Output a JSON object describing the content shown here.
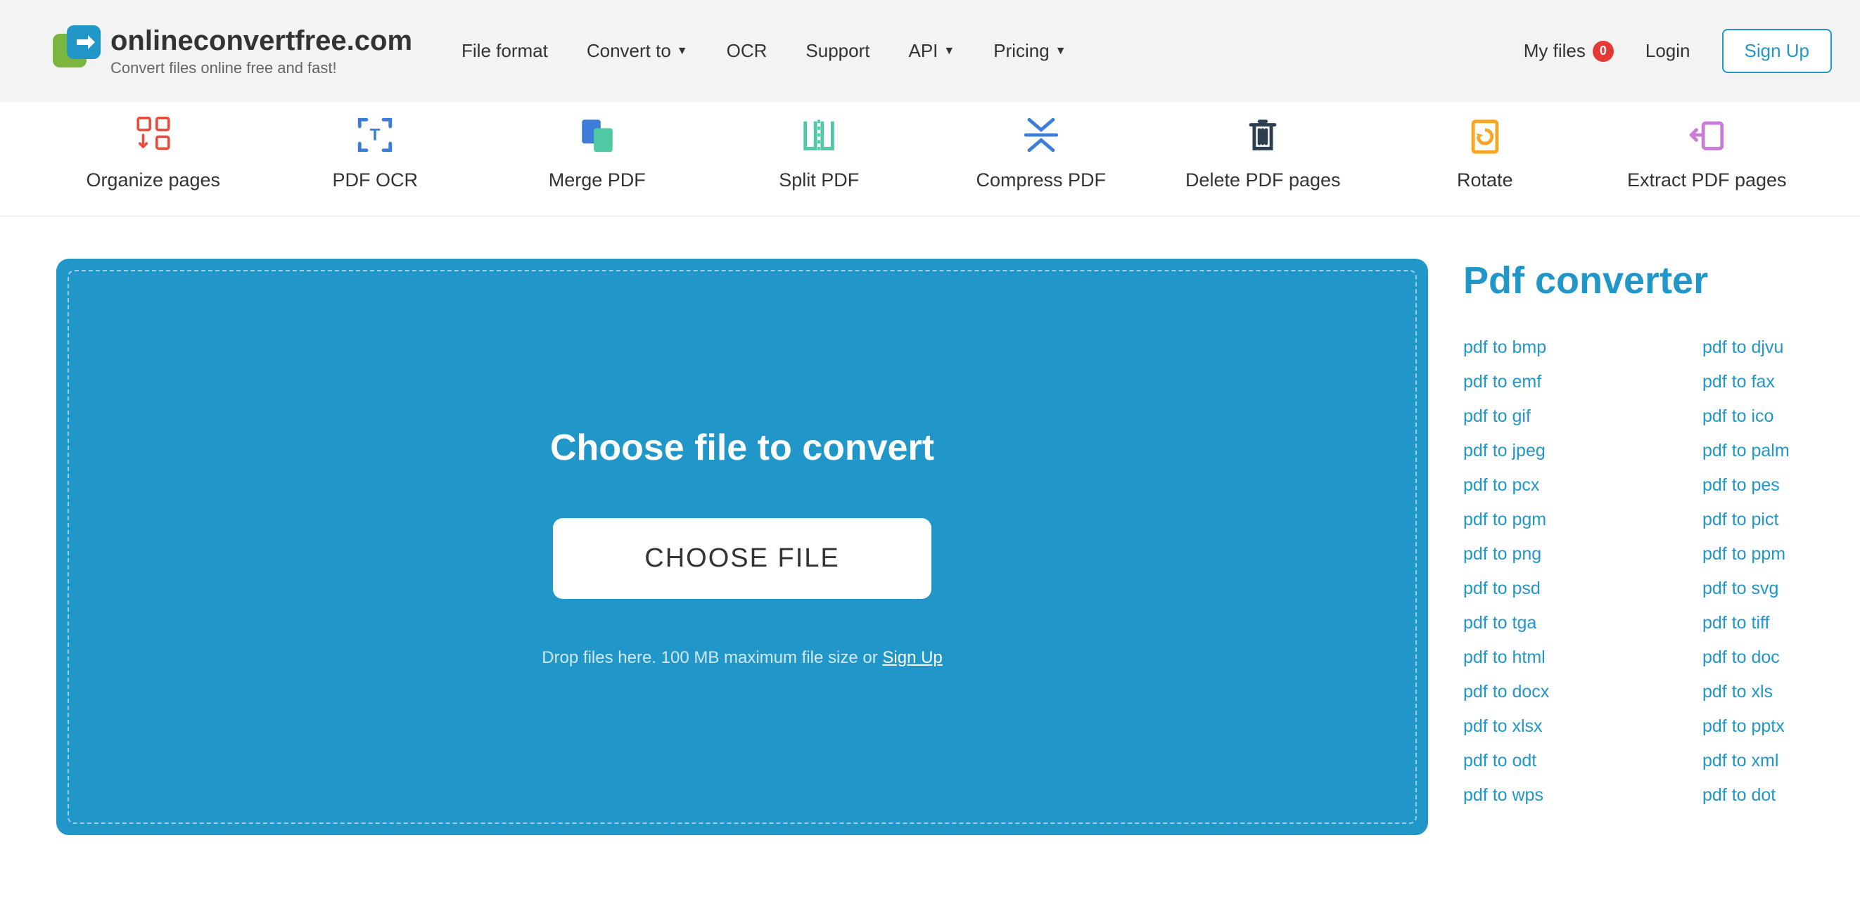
{
  "header": {
    "logo_title": "onlineconvertfree.com",
    "logo_sub": "Convert files online free and fast!",
    "nav": {
      "file_format": "File format",
      "convert_to": "Convert to",
      "ocr": "OCR",
      "support": "Support",
      "api": "API",
      "pricing": "Pricing"
    },
    "my_files": "My files",
    "my_files_count": "0",
    "login": "Login",
    "signup": "Sign Up"
  },
  "tools": {
    "organize": "Organize pages",
    "ocr": "PDF OCR",
    "merge": "Merge PDF",
    "split": "Split PDF",
    "compress": "Compress PDF",
    "delete": "Delete PDF pages",
    "rotate": "Rotate",
    "extract": "Extract PDF pages"
  },
  "dropzone": {
    "title": "Choose file to convert",
    "button": "CHOOSE FILE",
    "hint_prefix": "Drop files here. 100 MB maximum file size or ",
    "hint_link": "Sign Up"
  },
  "sidebar": {
    "title": "Pdf converter",
    "col1": [
      "pdf to bmp",
      "pdf to emf",
      "pdf to gif",
      "pdf to jpeg",
      "pdf to pcx",
      "pdf to pgm",
      "pdf to png",
      "pdf to psd",
      "pdf to tga",
      "pdf to html",
      "pdf to docx",
      "pdf to xlsx",
      "pdf to odt",
      "pdf to wps"
    ],
    "col2": [
      "pdf to djvu",
      "pdf to fax",
      "pdf to ico",
      "pdf to palm",
      "pdf to pes",
      "pdf to pict",
      "pdf to ppm",
      "pdf to svg",
      "pdf to tiff",
      "pdf to doc",
      "pdf to xls",
      "pdf to pptx",
      "pdf to xml",
      "pdf to dot"
    ]
  }
}
